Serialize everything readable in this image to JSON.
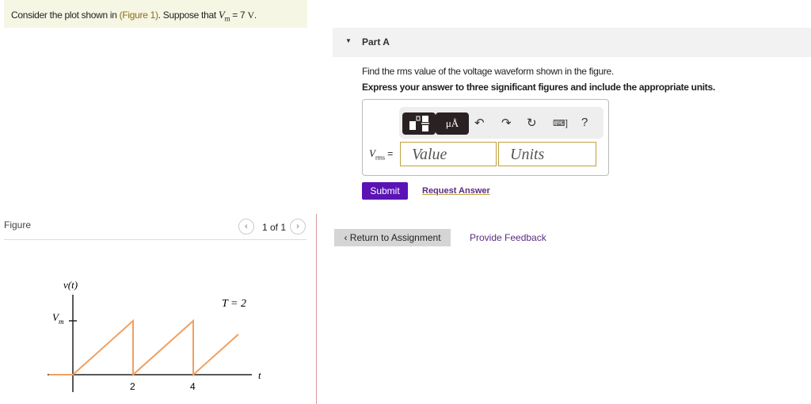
{
  "question": {
    "prefix": "Consider the plot shown in ",
    "link": "(Figure 1)",
    "mid": ". Suppose that ",
    "var": "V",
    "sub": "m",
    "value": " = 7 ",
    "unit": "V",
    "end": "."
  },
  "part": {
    "label": "Part A",
    "prompt": "Find the rms value of the voltage waveform shown in the figure.",
    "instructions": "Express your answer to three significant figures and include the appropriate units."
  },
  "toolbar": {
    "units_btn": "μÅ",
    "help": "?"
  },
  "answer": {
    "var": "V",
    "sub": "rms",
    "eq": " =",
    "value_placeholder": "Value",
    "units_placeholder": "Units"
  },
  "actions": {
    "submit": "Submit",
    "request": "Request Answer",
    "return": "Return to Assignment",
    "feedback": "Provide Feedback"
  },
  "figure": {
    "label": "Figure",
    "page": "1 of 1"
  },
  "chart_data": {
    "type": "line",
    "title": "",
    "ylabel": "v(t)",
    "xlabel": "t",
    "annotation": "T = 2",
    "ytick": "Vm",
    "xticks": [
      "2",
      "4"
    ],
    "series": [
      {
        "name": "v(t)",
        "x": [
          -1,
          0,
          2,
          2,
          4,
          4,
          5.5
        ],
        "y": [
          0,
          0,
          1,
          0,
          1,
          0,
          0.75
        ]
      }
    ],
    "xlim": [
      -1,
      6.5
    ],
    "ylim": [
      -0.5,
      1.4
    ],
    "color": "#f0a060"
  }
}
